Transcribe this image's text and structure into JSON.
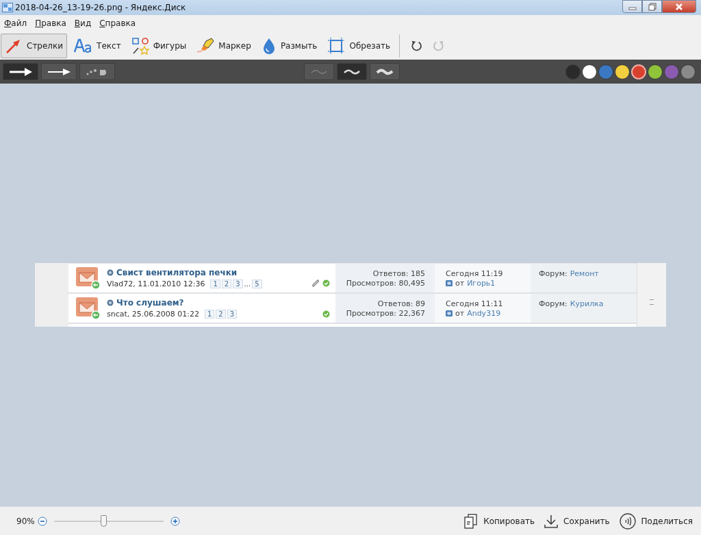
{
  "window": {
    "title": "2018-04-26_13-19-26.png - Яндекс.Диск"
  },
  "menu": [
    "Файл",
    "Правка",
    "Вид",
    "Справка"
  ],
  "tools": [
    {
      "kind": "arrow",
      "label": "Стрелки",
      "selected": true
    },
    {
      "kind": "text",
      "label": "Текст",
      "selected": false
    },
    {
      "kind": "shapes",
      "label": "Фигуры",
      "selected": false
    },
    {
      "kind": "marker",
      "label": "Маркер",
      "selected": false
    },
    {
      "kind": "blur",
      "label": "Размыть",
      "selected": false
    },
    {
      "kind": "crop",
      "label": "Обрезать",
      "selected": false
    }
  ],
  "history": [
    {
      "kind": "undo",
      "disabled": false
    },
    {
      "kind": "redo",
      "disabled": true
    }
  ],
  "arrow_styles": [
    {
      "kind": "thick",
      "selected": true
    },
    {
      "kind": "thin",
      "selected": false
    },
    {
      "kind": "dotted",
      "selected": false
    }
  ],
  "line_widths": [
    {
      "kind": "thin",
      "selected": false
    },
    {
      "kind": "medium",
      "selected": true
    },
    {
      "kind": "thick",
      "selected": false
    }
  ],
  "colors": [
    {
      "color": "#2a2a2a",
      "selected": false
    },
    {
      "color": "#ffffff",
      "selected": false
    },
    {
      "color": "#3a78c4",
      "selected": false
    },
    {
      "color": "#f2cf3e",
      "selected": false
    },
    {
      "color": "#d9412f",
      "selected": true
    },
    {
      "color": "#8fc43a",
      "selected": false
    },
    {
      "color": "#8a5bb0",
      "selected": false
    },
    {
      "color": "#8a8a8a",
      "selected": false
    }
  ],
  "image": {
    "rows": [
      {
        "title": "Свист вентилятора печки",
        "author_date": "Vlad72, 11.01.2010 12:36",
        "pages": [
          "1",
          "2",
          "3",
          "...",
          "5"
        ],
        "attachment": true,
        "replies": "Ответов: 185",
        "views": "Просмотров: 80,495",
        "last_time": "Сегодня 11:19",
        "last_prefix": "от",
        "last_by": "Игорь1",
        "forum_label": "Форум:",
        "forum": "Ремонт"
      },
      {
        "title": "Что слушаем?",
        "author_date": "sncat, 25.06.2008 01:22",
        "pages": [
          "1",
          "2",
          "3"
        ],
        "attachment": false,
        "replies": "Ответов: 89",
        "views": "Просмотров: 22,367",
        "last_time": "Сегодня 11:11",
        "last_prefix": "от",
        "last_by": "Andy319",
        "forum_label": "Форум:",
        "forum": "Курилка"
      }
    ]
  },
  "zoom": {
    "label": "90%",
    "level": 0.45
  },
  "actions": [
    {
      "kind": "copy",
      "label": "Копировать"
    },
    {
      "kind": "save",
      "label": "Сохранить"
    },
    {
      "kind": "share",
      "label": "Поделиться"
    }
  ]
}
